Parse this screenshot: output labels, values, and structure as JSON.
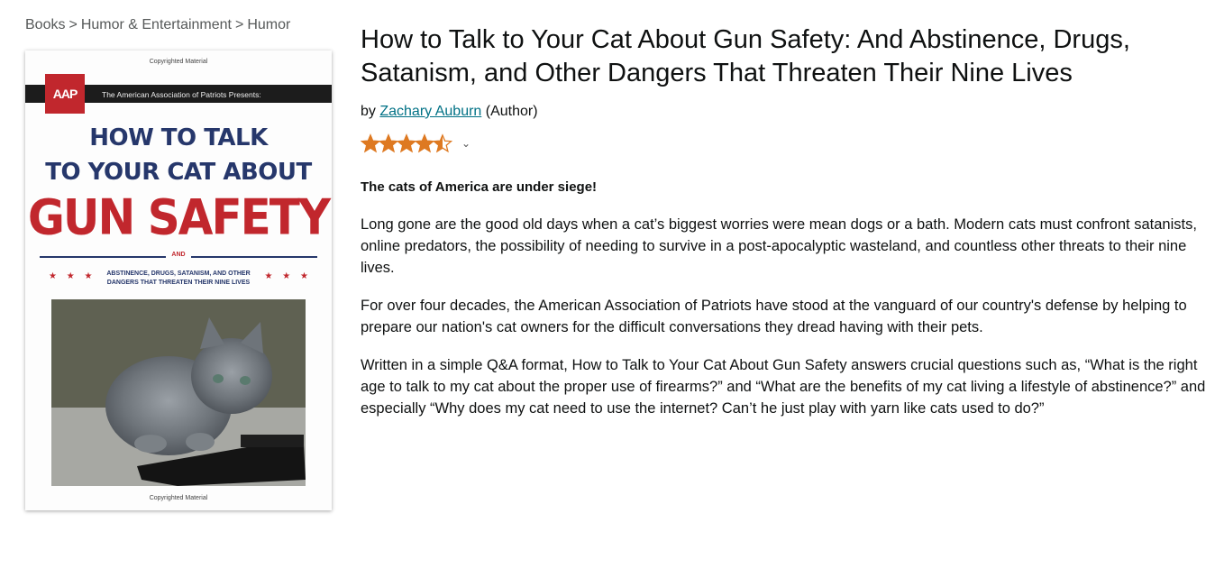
{
  "breadcrumb": {
    "items": [
      "Books",
      "Humor & Entertainment",
      "Humor"
    ],
    "separator": ">"
  },
  "cover": {
    "copyright_top": "Copyrighted Material",
    "copyright_bottom": "Copyrighted Material",
    "logo": "AAP",
    "band_text": "The American Association of Patriots Presents:",
    "title_line1": "HOW TO TALK",
    "title_line2": "TO YOUR CAT ABOUT",
    "title_line3": "GUN SAFETY",
    "and_text": "AND",
    "subtitle_line1": "ABSTINENCE, DRUGS, SATANISM, AND OTHER",
    "subtitle_line2": "DANGERS THAT THREATEN THEIR NINE LIVES",
    "stars_left": "★ ★ ★",
    "stars_right": "★ ★ ★"
  },
  "product": {
    "title": "How to Talk to Your Cat About Gun Safety: And Abstinence, Drugs, Satanism, and Other Dangers That Threaten Their Nine Lives",
    "by_prefix": "by",
    "author": "Zachary Auburn",
    "author_role": "(Author)",
    "rating": 4.5,
    "rating_max": 5,
    "star_color": "#de7921"
  },
  "description": {
    "lead": "The cats of America are under siege!",
    "p1": "Long gone are the good old days when a cat’s biggest worries were mean dogs or a bath. Modern cats must confront satanists, online predators, the possibility of needing to survive in a post-apocalyptic wasteland, and countless other threats to their nine lives.",
    "p2": "For over four decades, the American Association of Patriots have stood at the vanguard of our country's defense by helping to prepare our nation's cat owners for the difficult conversations they dread having with their pets.",
    "p3": "Written in a simple Q&A format, How to Talk to Your Cat About Gun Safety answers crucial questions such as, “What is the right age to talk to my cat about the proper use of firearms?” and “What are the benefits of my cat living a lifestyle of abstinence?” and especially “Why does my cat need to use the internet? Can’t he just play with yarn like cats used to do?”"
  }
}
